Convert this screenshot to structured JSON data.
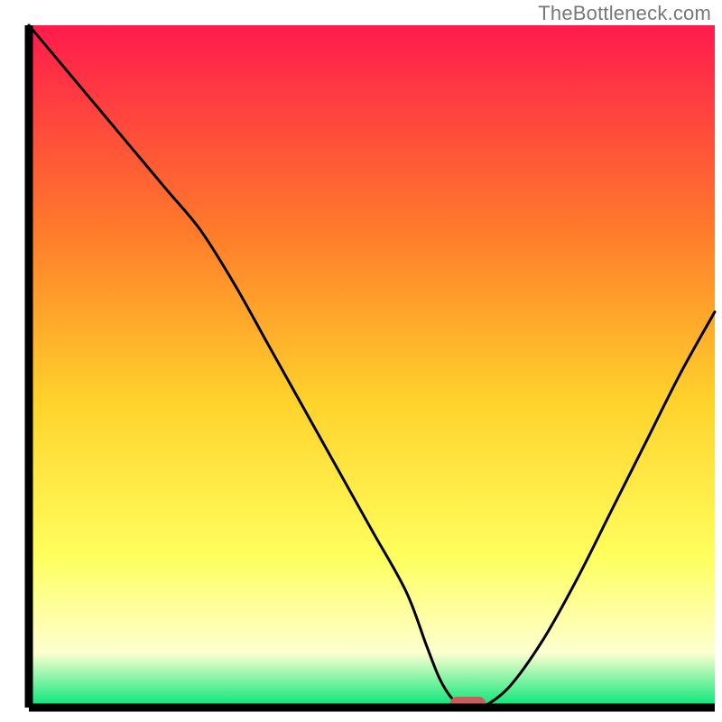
{
  "attribution": "TheBottleneck.com",
  "colors": {
    "gradient_top": "#ff1a4d",
    "gradient_mid1": "#ff7a2b",
    "gradient_mid2": "#ffd22b",
    "gradient_mid3": "#ffff5e",
    "gradient_mid4": "#fdffd0",
    "gradient_bottom": "#00e676",
    "axis": "#000000",
    "curve": "#000000",
    "marker": "#cc5b5b"
  },
  "chart_data": {
    "type": "line",
    "title": "",
    "xlabel": "",
    "ylabel": "",
    "xlim": [
      0,
      100
    ],
    "ylim": [
      0,
      100
    ],
    "x": [
      0,
      5,
      10,
      15,
      20,
      25,
      30,
      35,
      40,
      45,
      50,
      55,
      58,
      60,
      62,
      64,
      66,
      70,
      75,
      80,
      85,
      90,
      95,
      100
    ],
    "values": [
      100,
      94,
      88,
      82,
      76,
      70,
      62,
      53,
      44,
      35,
      26,
      17,
      9,
      4,
      1,
      0,
      0,
      3,
      10,
      19,
      29,
      39,
      49,
      58
    ],
    "marker_x": 64,
    "grid": false,
    "legend": false
  }
}
